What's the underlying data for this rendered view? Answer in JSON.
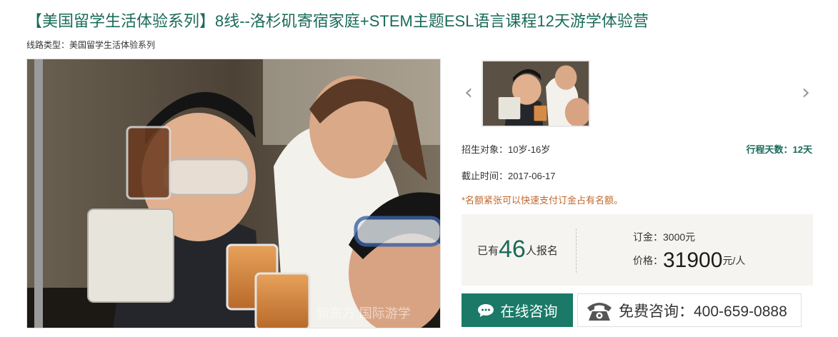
{
  "title": "【美国留学生活体验系列】8线--洛杉矶寄宿家庭+STEM主题ESL语言课程12天游学体验营",
  "route": {
    "label": "线路类型：",
    "value": "美国留学生活体验系列"
  },
  "photo": {
    "subject": "children-with-teacher-chemistry-lab",
    "watermark": "新东方 国际游学"
  },
  "gallery": {
    "prev_icon": "chevron-left-icon",
    "next_icon": "chevron-right-icon"
  },
  "info": {
    "target": "招生对象：10岁-16岁",
    "days": "行程天数：12天",
    "deadline": "截止时间：2017-06-17",
    "notice": "*名额紧张可以快速支付订金占有名额。"
  },
  "signup": {
    "prefix": "已有",
    "count": "46",
    "suffix": "人报名"
  },
  "deposit": "订金：3000元",
  "price": {
    "label": "价格：",
    "value": "31900",
    "unit": "元/人"
  },
  "buttons": {
    "consult": "在线咨询",
    "phone": "免费咨询：400-659-0888"
  },
  "colors": {
    "accent": "#1a6b5a",
    "notice": "#c0672d",
    "price_box_bg": "#f6f4f1"
  }
}
